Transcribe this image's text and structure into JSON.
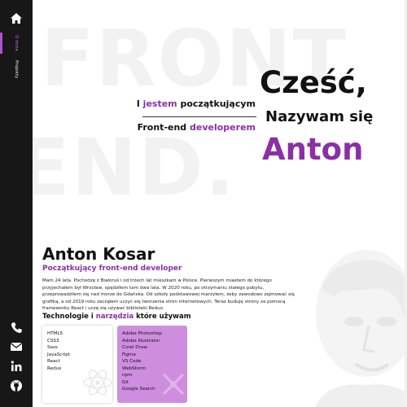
{
  "sidebar": {
    "home_icon": "home-icon",
    "nav": [
      {
        "label": "O mnie",
        "active": true
      },
      {
        "label": "Projekty",
        "active": false
      }
    ],
    "social_icons": [
      "phone-icon",
      "mail-icon",
      "linkedin-icon",
      "github-icon"
    ]
  },
  "background_words": [
    "FRONT",
    "END."
  ],
  "hero": {
    "line1_pre": "I ",
    "line1_accent": "jestem",
    "line1_post": " początkującym",
    "line2_pre": "Front-end ",
    "line2_accent": "developerem",
    "greeting": "Cześć,",
    "intro": "Nazywam się",
    "first_name": "Anton"
  },
  "about": {
    "name": "Anton Kosar",
    "role": "Początkujący front-end developer",
    "bio": "Mam 24 lata. Pochodzę z Białoruś i od trzech lat mieszkam w Polsce. Pierwszym miastem do którego przyjechałem był Wrocław, spędziłem tam dwa lata. W 2020 roku, po otrzymaniu stałego pobytu, przeprowadziłem się nad morze do Gdańska. Od szkoły podstawowej marzyłem, żeby zawodowo zajmować się grafiką, a od 2019 roku zacząłem uczyć się tworzenia stron internetowych. Teraz buduję strony za pomocą frameworku React i uczę się używać biblioteki Redux."
  },
  "tech": {
    "title_pre": "Technologie i ",
    "title_accent": "narzędzia",
    "title_post": " które używam",
    "technologies": [
      "HTML5",
      "CSS3",
      "Sass",
      "JavaScript",
      "React",
      "Redux"
    ],
    "tools": [
      "Adobe Photoshop",
      "Adobe Illustrator",
      "Corel Draw",
      "Figma",
      "VS Code",
      "WebStorm",
      "npm",
      "Git",
      "Google Search"
    ]
  },
  "colors": {
    "accent": "#8b2fa6",
    "sidebar": "#171717",
    "tools_card": "#cf8de0"
  }
}
